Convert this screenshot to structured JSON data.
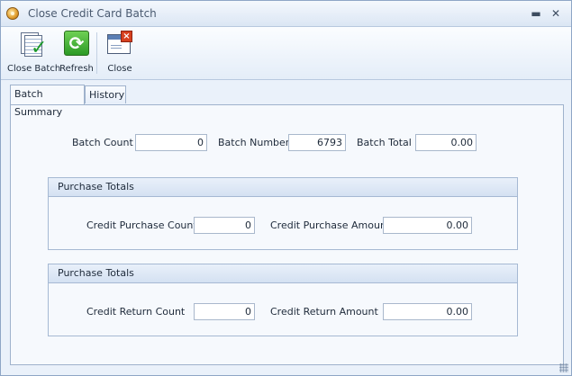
{
  "window": {
    "title": "Close Credit Card Batch",
    "minimize_glyph": "▬",
    "close_glyph": "✕"
  },
  "toolbar": {
    "close_batch_label": "Close Batch",
    "refresh_label": "Refresh",
    "close_label": "Close",
    "close_batch_icon": "document-check-icon",
    "refresh_icon": "refresh-icon",
    "close_icon": "window-close-icon"
  },
  "tabs": [
    {
      "label": "Batch Summary",
      "active": true
    },
    {
      "label": "History",
      "active": false
    }
  ],
  "batch": {
    "count_label": "Batch Count",
    "count_value": "0",
    "number_label": "Batch Number",
    "number_value": "6793",
    "total_label": "Batch Total",
    "total_value": "0.00"
  },
  "purchase_group": {
    "header": "Purchase Totals",
    "count_label": "Credit Purchase Count",
    "count_value": "0",
    "amount_label": "Credit Purchase Amount",
    "amount_value": "0.00"
  },
  "return_group": {
    "header": "Purchase Totals",
    "count_label": "Credit Return Count",
    "count_value": "0",
    "amount_label": "Credit Return Amount",
    "amount_value": "0.00"
  }
}
